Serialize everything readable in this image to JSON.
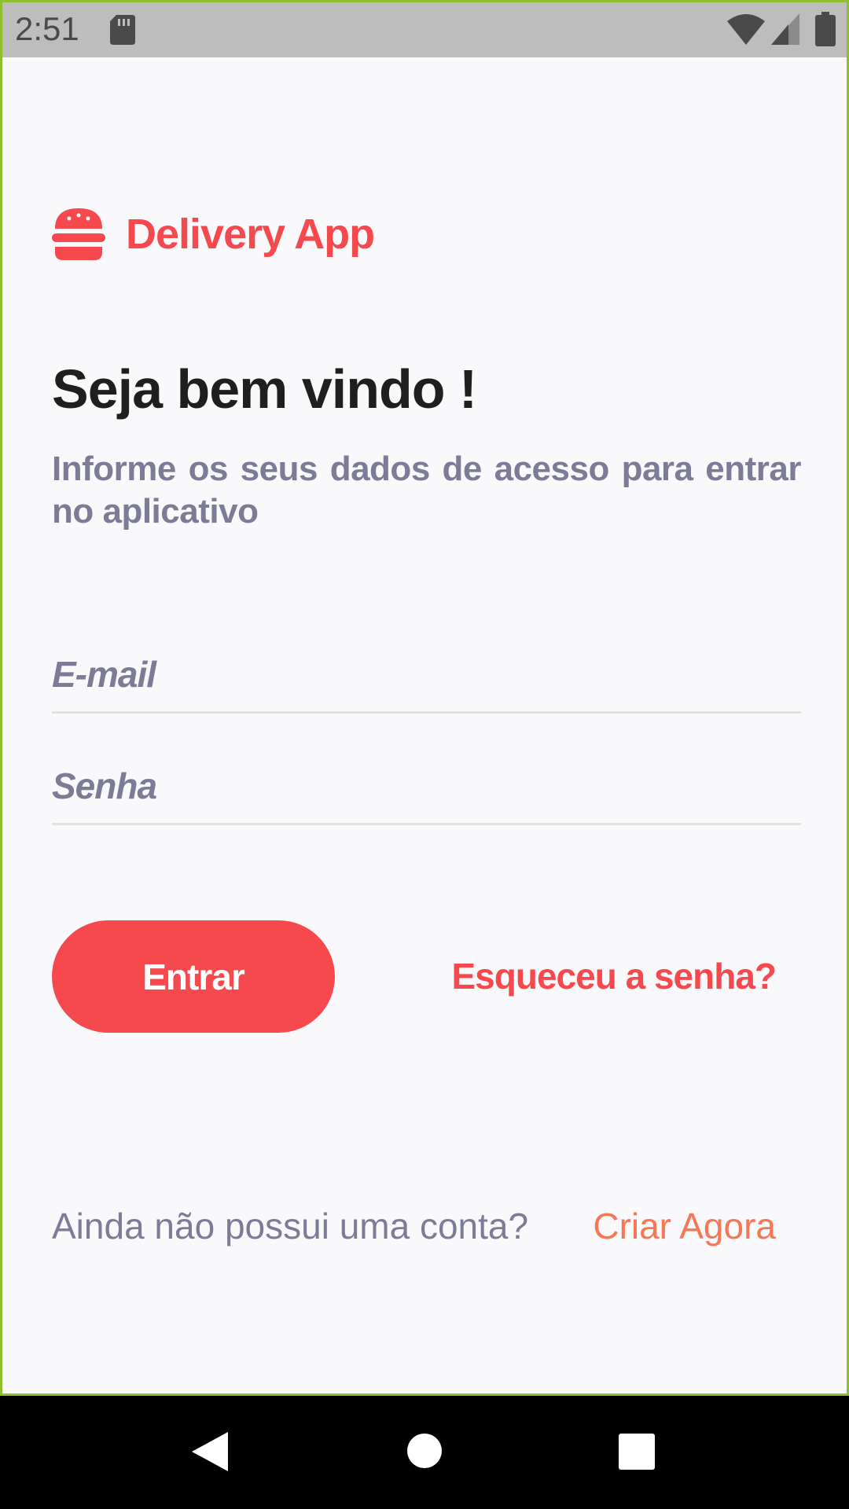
{
  "status_bar": {
    "time": "2:51",
    "icons": [
      "sd-card-icon",
      "wifi-icon",
      "signal-icon",
      "battery-icon"
    ]
  },
  "brand": {
    "icon": "burger-icon",
    "name": "Delivery App"
  },
  "welcome": {
    "title": "Seja bem vindo !",
    "subtitle": "Informe os seus dados de acesso para entrar no aplicativo"
  },
  "form": {
    "email_placeholder": "E-mail",
    "email_value": "",
    "password_placeholder": "Senha",
    "password_value": "",
    "login_label": "Entrar",
    "forgot_label": "Esqueceu a senha?"
  },
  "signup": {
    "prompt": "Ainda não possui uma conta?",
    "link_label": "Criar Agora"
  },
  "nav_bar": {
    "icons": [
      "back-icon",
      "home-icon",
      "recents-icon"
    ]
  },
  "colors": {
    "accent": "#f6494d",
    "link_secondary": "#f57756",
    "muted_text": "#7d7c96",
    "background": "#f9f9fb"
  }
}
